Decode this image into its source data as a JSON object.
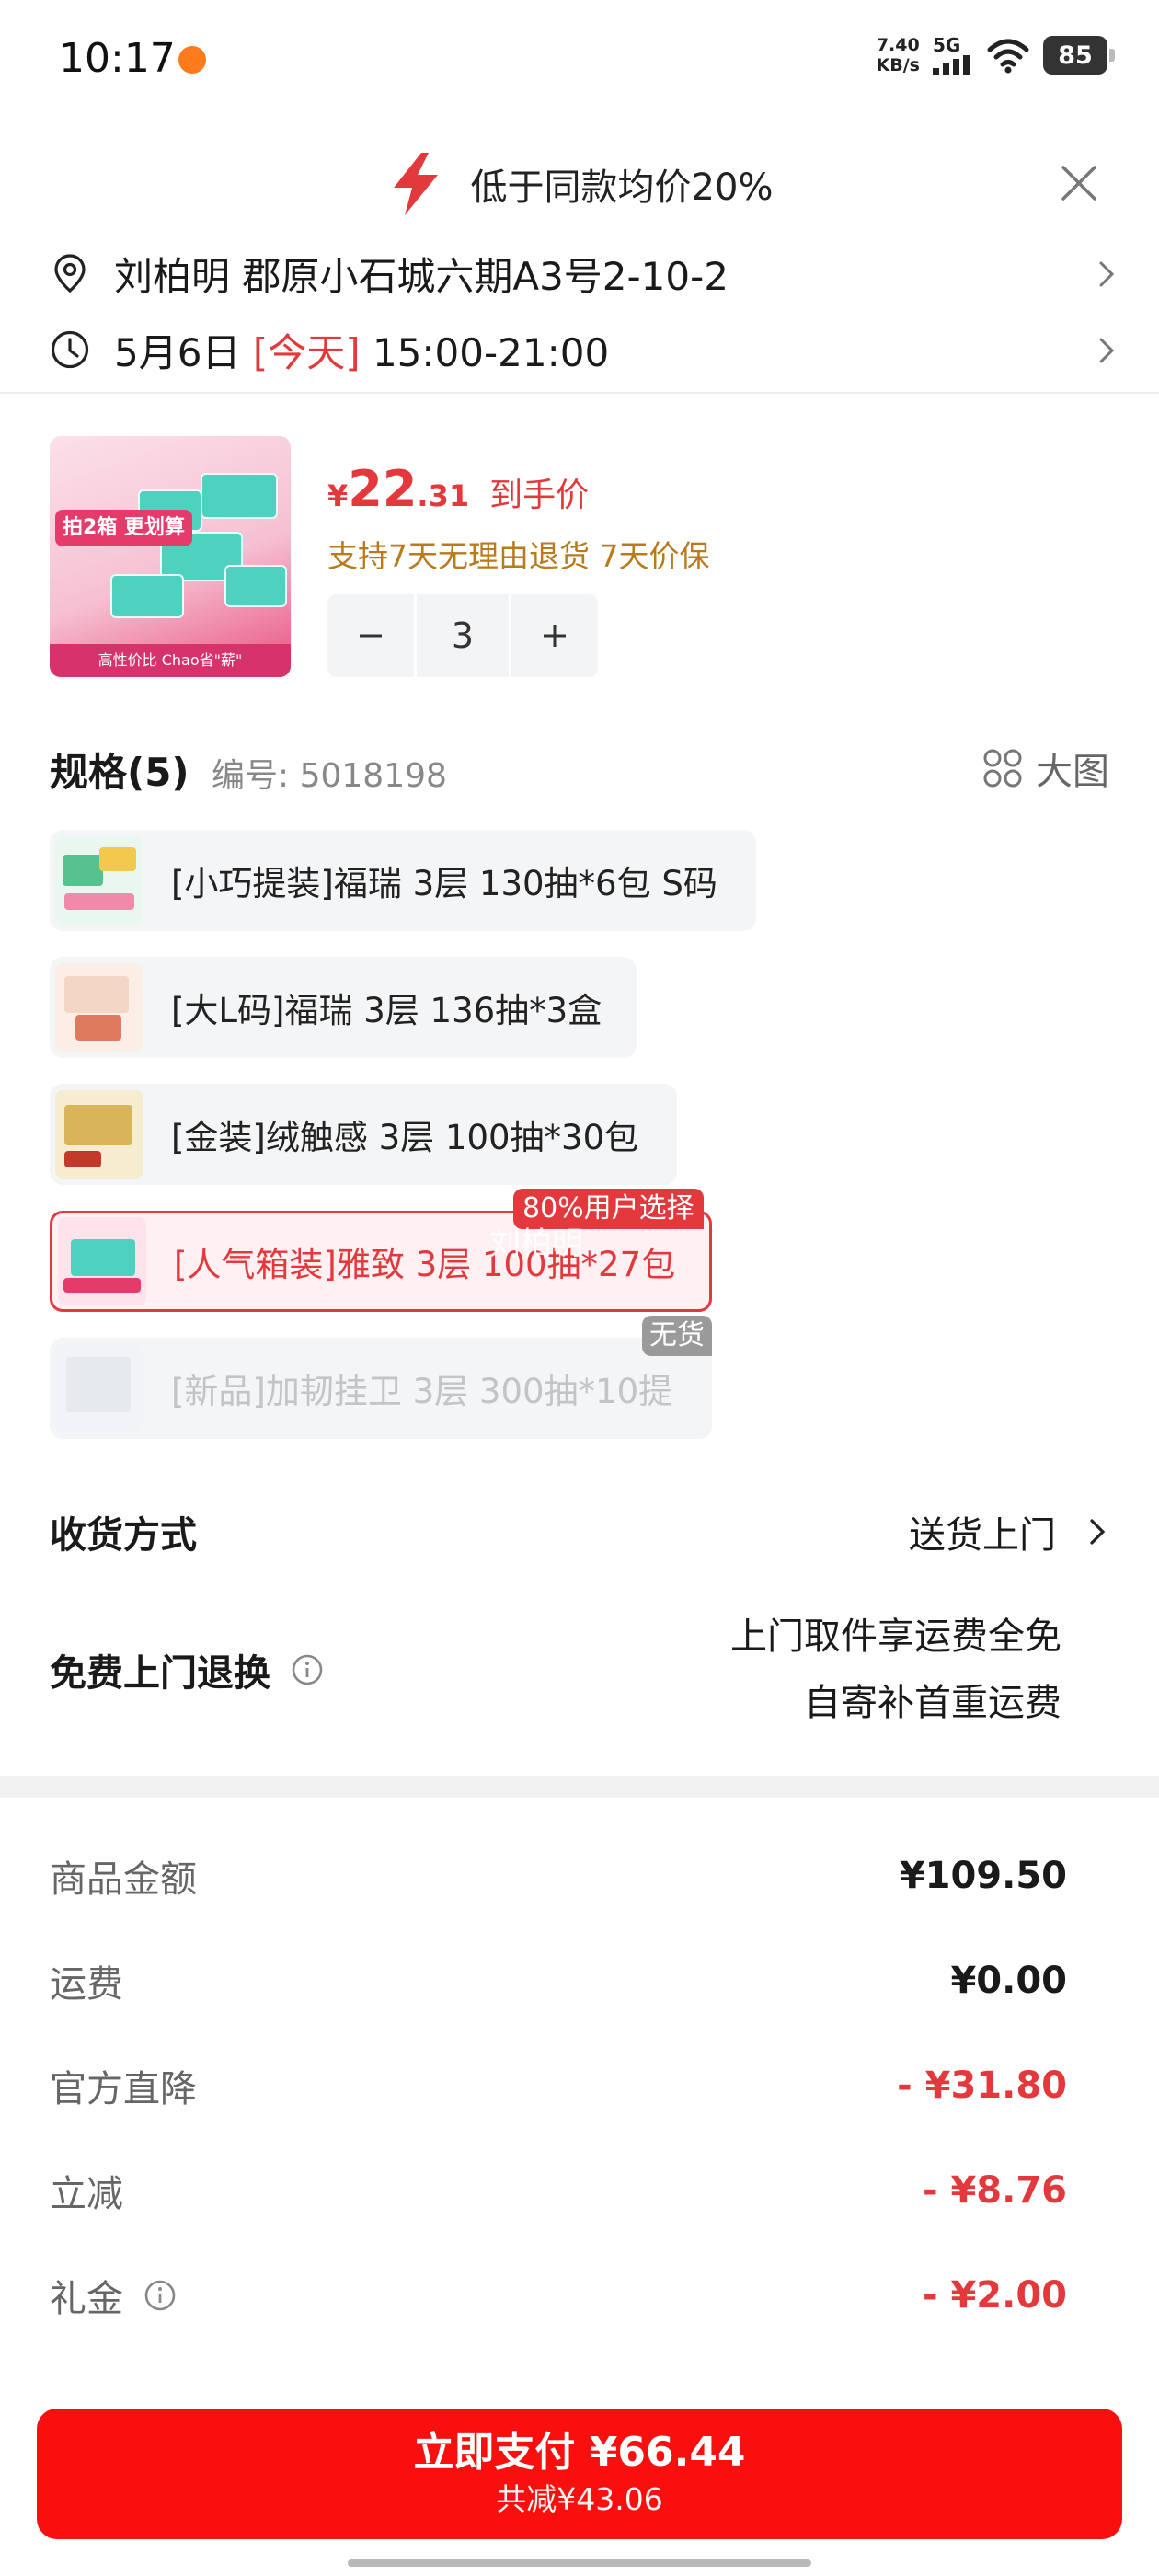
{
  "status_bar": {
    "time": "10:17",
    "net_speed": "7.40",
    "net_unit": "KB/s",
    "network": "5G",
    "battery": "85"
  },
  "promo": {
    "text": "低于同款均价20%",
    "icon": "lightning-bolt-icon",
    "accent": "#e4393c"
  },
  "address": {
    "text": "刘柏明  郡原小石城六期A3号2-10-2"
  },
  "delivery_time": {
    "date": "5月6日",
    "today": "[今天]",
    "window": "15:00-21:00"
  },
  "product": {
    "price_symbol": "¥",
    "price_int": "22",
    "price_dec": ".31",
    "price_label": "到手价",
    "guarantee": "支持7天无理由退货  7天价保",
    "quantity": "3",
    "image_tag": "拍2箱 更划算",
    "image_footer": "高性价比 Chao省\"薪\""
  },
  "spec": {
    "title": "规格(5)",
    "code": "编号: 5018198",
    "big_image_label": "大图",
    "options": [
      {
        "label": "[小巧提装]福瑞 3层 130抽*6包 S码",
        "state": "normal"
      },
      {
        "label": "[大L码]福瑞 3层 136抽*3盒",
        "state": "normal"
      },
      {
        "label": "[金装]绒触感 3层 100抽*30包",
        "state": "normal"
      },
      {
        "label": "[人气箱装]雅致 3层 100抽*27包",
        "state": "selected"
      },
      {
        "label": "[新品]加韧挂卫 3层 300抽*10提",
        "state": "disabled"
      }
    ],
    "popular_badge": "80%用户选择",
    "out_of_stock_badge": "无货",
    "watermark": "刘柏明"
  },
  "shipping": {
    "label": "收货方式",
    "value": "送货上门"
  },
  "returns": {
    "label": "免费上门退换",
    "line1": "上门取件享运费全免",
    "line2": "自寄补首重运费"
  },
  "fees": [
    {
      "label": "商品金额",
      "value": "¥109.50",
      "red": false
    },
    {
      "label": "运费",
      "value": "¥0.00",
      "red": false
    },
    {
      "label": "官方直降",
      "value": "- ¥31.80",
      "red": true
    },
    {
      "label": "立减",
      "value": "- ¥8.76",
      "red": true
    },
    {
      "label": "礼金",
      "value": "- ¥2.00",
      "red": true
    }
  ],
  "pay": {
    "main": "立即支付 ¥66.44",
    "sub": "共减¥43.06"
  },
  "colors": {
    "brand_red": "#e4393c",
    "pay_red": "#fa0f0f",
    "guarantee_gold": "#b87a1a"
  }
}
